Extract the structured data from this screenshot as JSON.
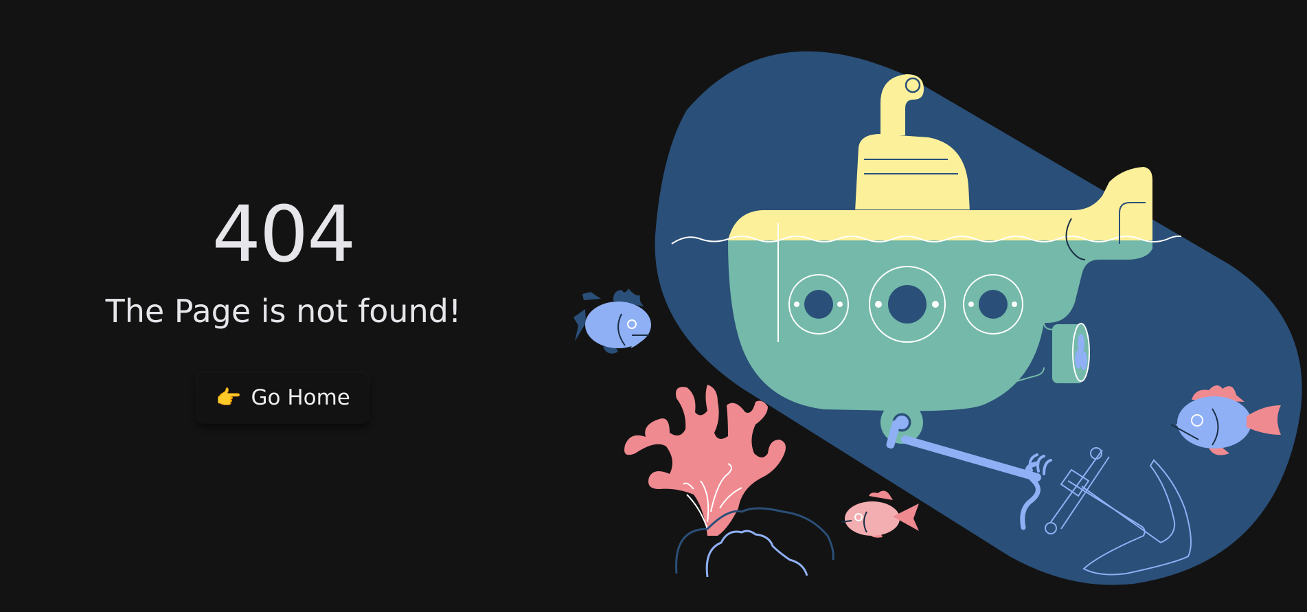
{
  "error": {
    "code": "404",
    "message": "The Page is not found!"
  },
  "home_button": {
    "icon": "pointing-hand-icon",
    "label": "Go Home"
  },
  "illustration": {
    "icon": "submarine-underwater-illustration",
    "colors": {
      "background": "#131313",
      "ocean": "#2a4f78",
      "submarine_top": "#fdf09a",
      "submarine_body": "#74b9aa",
      "coral": "#ef8a90",
      "fish_blue": "#8fb0f5",
      "fish_pink": "#f2aeb0"
    }
  }
}
